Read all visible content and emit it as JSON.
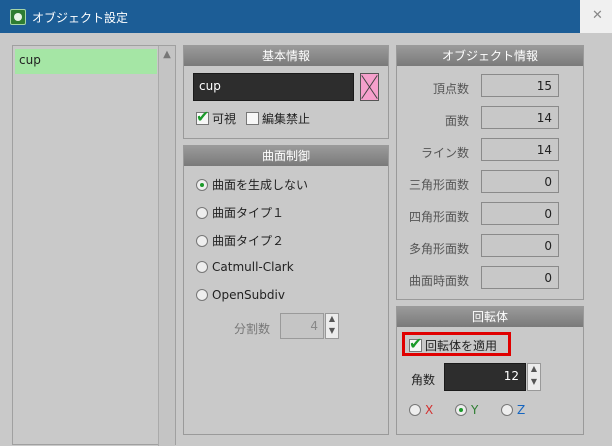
{
  "window": {
    "title": "オブジェクト設定"
  },
  "objects": {
    "items": [
      "cup"
    ]
  },
  "basic_info": {
    "header": "基本情報",
    "name_value": "cup",
    "visible_label": "可視",
    "visible_checked": true,
    "edit_lock_label": "編集禁止",
    "edit_lock_checked": false
  },
  "curve_control": {
    "header": "曲面制御",
    "options": [
      "曲面を生成しない",
      "曲面タイプ１",
      "曲面タイプ２",
      "Catmull-Clark",
      "OpenSubdiv"
    ],
    "selected_index": 0,
    "subdiv_label": "分割数",
    "subdiv_value": "4"
  },
  "object_info": {
    "header": "オブジェクト情報",
    "rows": [
      {
        "label": "頂点数",
        "value": "15"
      },
      {
        "label": "面数",
        "value": "14"
      },
      {
        "label": "ライン数",
        "value": "14"
      },
      {
        "label": "三角形面数",
        "value": "0"
      },
      {
        "label": "四角形面数",
        "value": "0"
      },
      {
        "label": "多角形面数",
        "value": "0"
      },
      {
        "label": "曲面時面数",
        "value": "0"
      }
    ]
  },
  "lathe": {
    "header": "回転体",
    "apply_label": "回転体を適用",
    "apply_checked": true,
    "angle_label": "角数",
    "angle_value": "12",
    "axes": [
      {
        "label": "X",
        "color": "#d32f2f",
        "selected": false
      },
      {
        "label": "Y",
        "color": "#2e7d32",
        "selected": true
      },
      {
        "label": "Z",
        "color": "#1565c0",
        "selected": false
      }
    ]
  },
  "colors": {
    "title_bar": "#1c5d96",
    "selection": "#a5e6a5",
    "highlight": "#e00000"
  }
}
